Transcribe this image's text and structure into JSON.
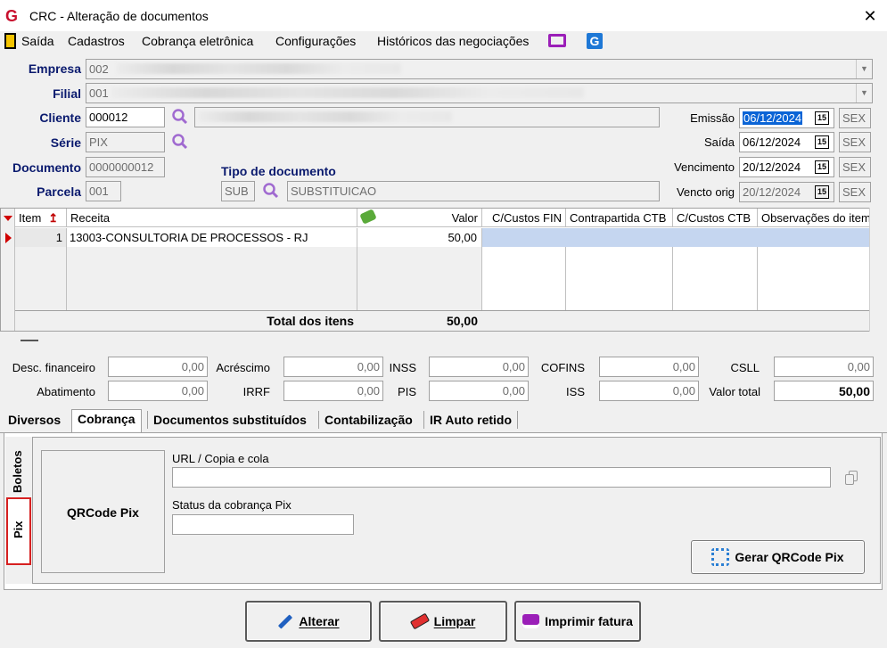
{
  "window": {
    "title": "CRC - Alteração de documentos",
    "logo": "G",
    "close": "✕"
  },
  "menu": [
    "Saída",
    "Cadastros",
    "Cobrança eletrônica",
    "Configurações",
    "Históricos das negociações"
  ],
  "header": {
    "empresa_label": "Empresa",
    "empresa_value": "002",
    "filial_label": "Filial",
    "filial_value": "001",
    "cliente_label": "Cliente",
    "cliente_value": "000012",
    "serie_label": "Série",
    "serie_value": "PIX",
    "documento_label": "Documento",
    "documento_value": "0000000012",
    "parcela_label": "Parcela",
    "parcela_value": "001",
    "tipo_label": "Tipo de documento",
    "tipo_code": "SUB",
    "tipo_desc": "SUBSTITUICAO",
    "emissao_label": "Emissão",
    "emissao_value": "06/12/2024",
    "emissao_day": "SEX",
    "saida_label": "Saída",
    "saida_value": "06/12/2024",
    "saida_day": "SEX",
    "venc_label": "Vencimento",
    "venc_value": "20/12/2024",
    "venc_day": "SEX",
    "vencorig_label": "Vencto orig",
    "vencorig_value": "20/12/2024",
    "vencorig_day": "SEX",
    "cal_glyph": "15"
  },
  "grid": {
    "columns": [
      "Item",
      "Receita",
      "Valor",
      "C/Custos FIN",
      "Contrapartida CTB",
      "C/Custos CTB",
      "Observações do item"
    ],
    "rows": [
      {
        "item": "1",
        "receita": "13003-CONSULTORIA DE PROCESSOS - RJ",
        "valor": "50,00"
      }
    ],
    "total_label": "Total dos itens",
    "total_value": "50,00"
  },
  "totals": {
    "desc_fin_label": "Desc. financeiro",
    "desc_fin": "0,00",
    "acrescimo_label": "Acréscimo",
    "acrescimo": "0,00",
    "inss_label": "INSS",
    "inss": "0,00",
    "cofins_label": "COFINS",
    "cofins": "0,00",
    "csll_label": "CSLL",
    "csll": "0,00",
    "abatimento_label": "Abatimento",
    "abatimento": "0,00",
    "irrf_label": "IRRF",
    "irrf": "0,00",
    "pis_label": "PIS",
    "pis": "0,00",
    "iss_label": "ISS",
    "iss": "0,00",
    "valor_total_label": "Valor total",
    "valor_total": "50,00"
  },
  "tabs": [
    "Diversos",
    "Cobrança",
    "Documentos substituídos",
    "Contabilização",
    "IR Auto retido"
  ],
  "subtabs": [
    "Boletos",
    "Pix"
  ],
  "pix": {
    "qrcode_label": "QRCode Pix",
    "url_label": "URL / Copia e cola",
    "url_value": "",
    "status_label": "Status da cobrança Pix",
    "status_value": "",
    "gerar_button": "Gerar QRCode Pix"
  },
  "footer": {
    "alterar": "Alterar",
    "limpar": "Limpar",
    "imprimir": "Imprimir fatura"
  }
}
